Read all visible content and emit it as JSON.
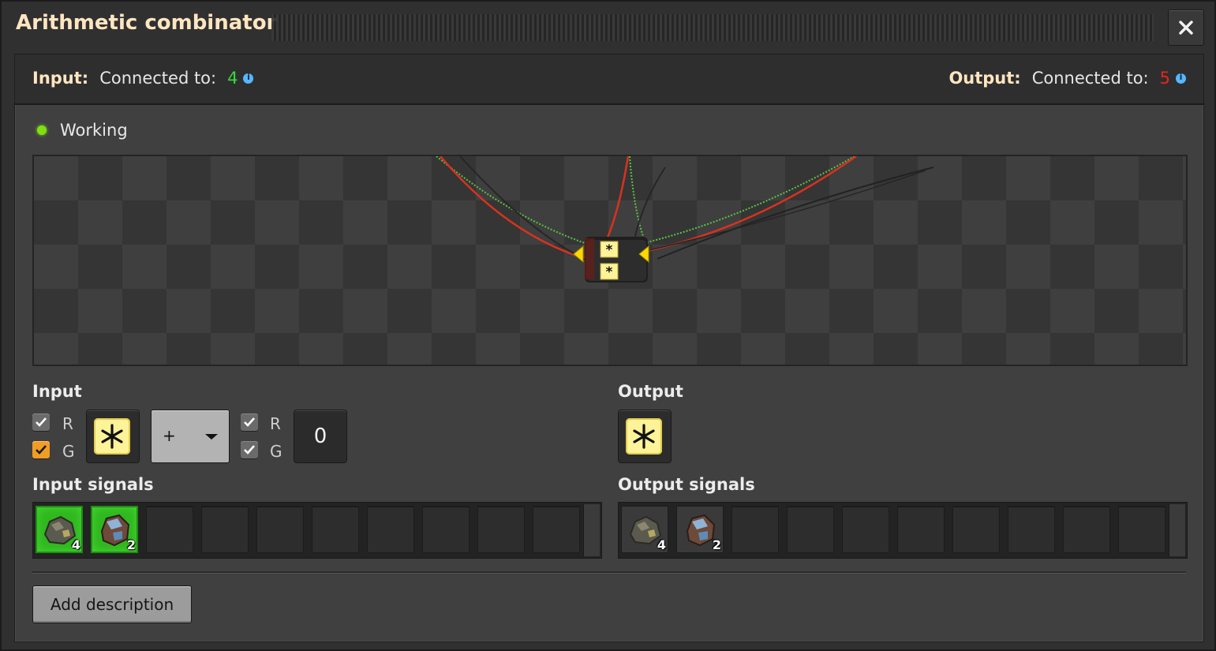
{
  "window": {
    "title": "Arithmetic combinator"
  },
  "connections": {
    "input": {
      "label": "Input:",
      "text": "Connected to:",
      "count": "4",
      "color": "#36d93b"
    },
    "output": {
      "label": "Output:",
      "text": "Connected to:",
      "count": "5",
      "color": "#e8261a"
    }
  },
  "status": {
    "text": "Working",
    "color": "#7ee011"
  },
  "input_section": {
    "label": "Input",
    "left_wires": {
      "red": {
        "label": "R",
        "checked": true
      },
      "green": {
        "label": "G",
        "checked": true
      }
    },
    "left_signal": "asterisk-each-icon",
    "operator": "+",
    "right_wires": {
      "red": {
        "label": "R",
        "checked": true
      },
      "green": {
        "label": "G",
        "checked": true
      }
    },
    "constant": "0"
  },
  "output_section": {
    "label": "Output",
    "signal": "asterisk-each-icon"
  },
  "input_signals": {
    "label": "Input signals",
    "items": [
      {
        "icon": "stone-ore-icon",
        "count": "4"
      },
      {
        "icon": "iron-ore-icon",
        "count": "2"
      }
    ]
  },
  "output_signals": {
    "label": "Output signals",
    "items": [
      {
        "icon": "stone-ore-icon",
        "count": "4"
      },
      {
        "icon": "iron-ore-icon",
        "count": "2"
      }
    ]
  },
  "description_button": "Add description"
}
